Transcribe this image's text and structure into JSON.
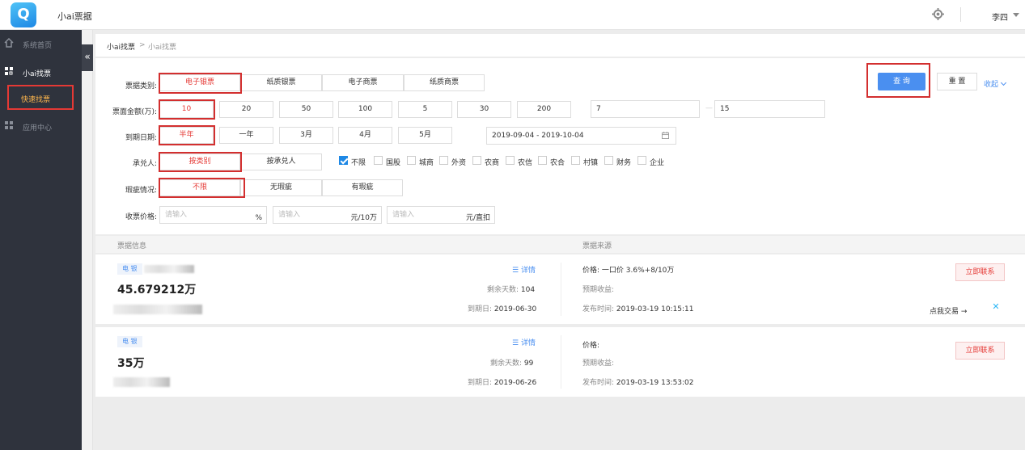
{
  "header": {
    "app_title": "小ai票据",
    "user_name": "李四",
    "logo_letter": "Q"
  },
  "sidebar": {
    "items": [
      {
        "label": "系统首页",
        "icon": "home-icon"
      },
      {
        "label": "小ai找票",
        "icon": "ticket-icon"
      },
      {
        "label": "应用中心",
        "icon": "apps-icon"
      }
    ],
    "sub_item": "快速找票",
    "collapse_symbol": "«"
  },
  "breadcrumb": {
    "root": "小ai找票",
    "sep": ">",
    "current": "小ai找票"
  },
  "filters": {
    "bill_type": {
      "label": "票据类别:",
      "options": [
        "电子银票",
        "纸质银票",
        "电子商票",
        "纸质商票"
      ]
    },
    "amount": {
      "label": "票面金额(万):",
      "options": [
        "10",
        "20",
        "50",
        "100",
        "5",
        "30",
        "200"
      ],
      "range_from": "7",
      "range_sep": "—",
      "range_to": "15"
    },
    "due_date": {
      "label": "到期日期:",
      "options": [
        "半年",
        "一年",
        "3月",
        "4月",
        "5月"
      ],
      "date_range": "2019-09-04 - 2019-10-04"
    },
    "acceptor": {
      "label": "承兑人:",
      "options": [
        "按类别",
        "按承兑人"
      ],
      "checkboxes": [
        "不限",
        "国股",
        "城商",
        "外资",
        "农商",
        "农信",
        "农合",
        "村镇",
        "财务",
        "企业"
      ]
    },
    "flaw": {
      "label": "瑕疵情况:",
      "options": [
        "不限",
        "无瑕疵",
        "有瑕疵"
      ]
    },
    "price": {
      "label": "收票价格:",
      "placeholder": "请输入",
      "unit1": "%",
      "unit2": "元/10万",
      "unit3": "元/直扣"
    },
    "query_label": "查 询",
    "reset_label": "重 置",
    "collapse_label": "收起"
  },
  "table": {
    "col_info": "票据信息",
    "col_source": "票据来源"
  },
  "results": [
    {
      "tag": "电 银",
      "amount": "45.679212万",
      "detail_label": "详情",
      "days_label": "剩余天数:",
      "days": "104",
      "due_label": "到期日:",
      "due": "2019-06-30",
      "price_label": "价格:",
      "price": "一口价 3.6%+8/10万",
      "profit_label": "预期收益:",
      "publish_label": "发布时间:",
      "publish": "2019-03-19 10:15:11",
      "contact_label": "立即联系",
      "trade_label": "点我交易 →"
    },
    {
      "tag": "电 银",
      "amount": "35万",
      "detail_label": "详情",
      "days_label": "剩余天数:",
      "days": "99",
      "due_label": "到期日:",
      "due": "2019-06-26",
      "price_label": "价格:",
      "price": "",
      "profit_label": "预期收益:",
      "publish_label": "发布时间:",
      "publish": "2019-03-19 13:53:02",
      "contact_label": "立即联系"
    }
  ],
  "colors": {
    "accent": "#4a8ff0",
    "highlight": "#d32f2f",
    "sidebar": "#2f333d"
  }
}
